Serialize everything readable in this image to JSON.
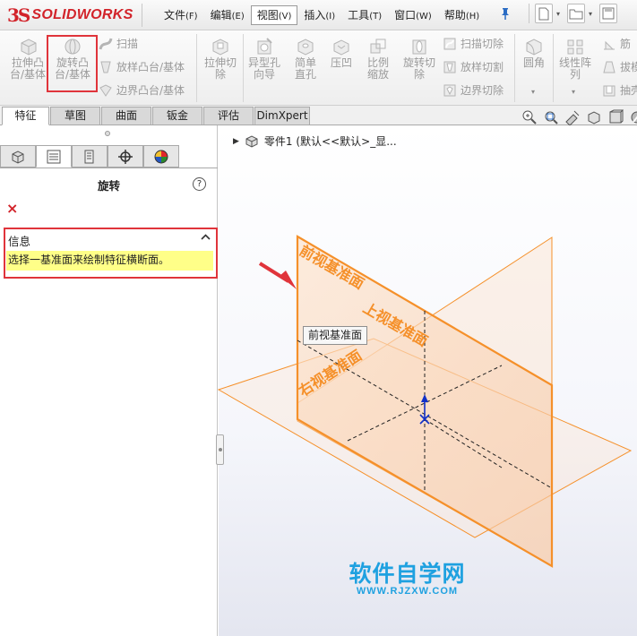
{
  "app": {
    "logo_prefix": "3S",
    "logo_text": "SOLIDWORKS"
  },
  "menu": [
    {
      "label": "文件",
      "key": "(F)"
    },
    {
      "label": "编辑",
      "key": "(E)"
    },
    {
      "label": "视图",
      "key": "(V)"
    },
    {
      "label": "插入",
      "key": "(I)"
    },
    {
      "label": "工具",
      "key": "(T)"
    },
    {
      "label": "窗口",
      "key": "(W)"
    },
    {
      "label": "帮助",
      "key": "(H)"
    }
  ],
  "ribbon": {
    "extrude_boss": "拉伸凸台/基体",
    "revolve_boss": "旋转凸台/基体",
    "sweep": "扫描",
    "loft_boss": "放样凸台/基体",
    "boundary_boss": "边界凸台/基体",
    "extrude_cut": "拉伸切除",
    "hole_wizard": "异型孔向导",
    "simple_hole": "简单直孔",
    "indent": "压凹",
    "scale": "比例缩放",
    "revolve_cut": "旋转切除",
    "swept_cut": "扫描切除",
    "lofted_cut": "放样切割",
    "boundary_cut": "边界切除",
    "fillet": "圆角",
    "linear_pattern": "线性阵列",
    "rib": "筋",
    "draft": "拔模",
    "shell": "抽壳"
  },
  "tabs": [
    "特征",
    "草图",
    "曲面",
    "钣金",
    "评估",
    "DimXpert"
  ],
  "property_manager": {
    "title": "旋转",
    "help": "?",
    "cancel": "×",
    "info_header": "信息",
    "info_chevron": "︿",
    "info_message": "选择一基准面来绘制特征横断面。"
  },
  "feature_tree": {
    "part_label": "零件1 (默认<<默认>_显..."
  },
  "viewport": {
    "tooltip": "前视基准面",
    "front_plane": "前视基准面",
    "top_plane": "上视基准面",
    "right_plane": "右视基准面"
  },
  "watermark": {
    "title": "软件自学网",
    "url": "WWW.RJZXW.COM"
  },
  "colors": {
    "plane_orange": "#f5902a",
    "highlight_red": "#e0343b",
    "info_yellow": "#ffff88",
    "watermark_blue": "#1fa1e0",
    "logo_red": "#d2232a"
  }
}
